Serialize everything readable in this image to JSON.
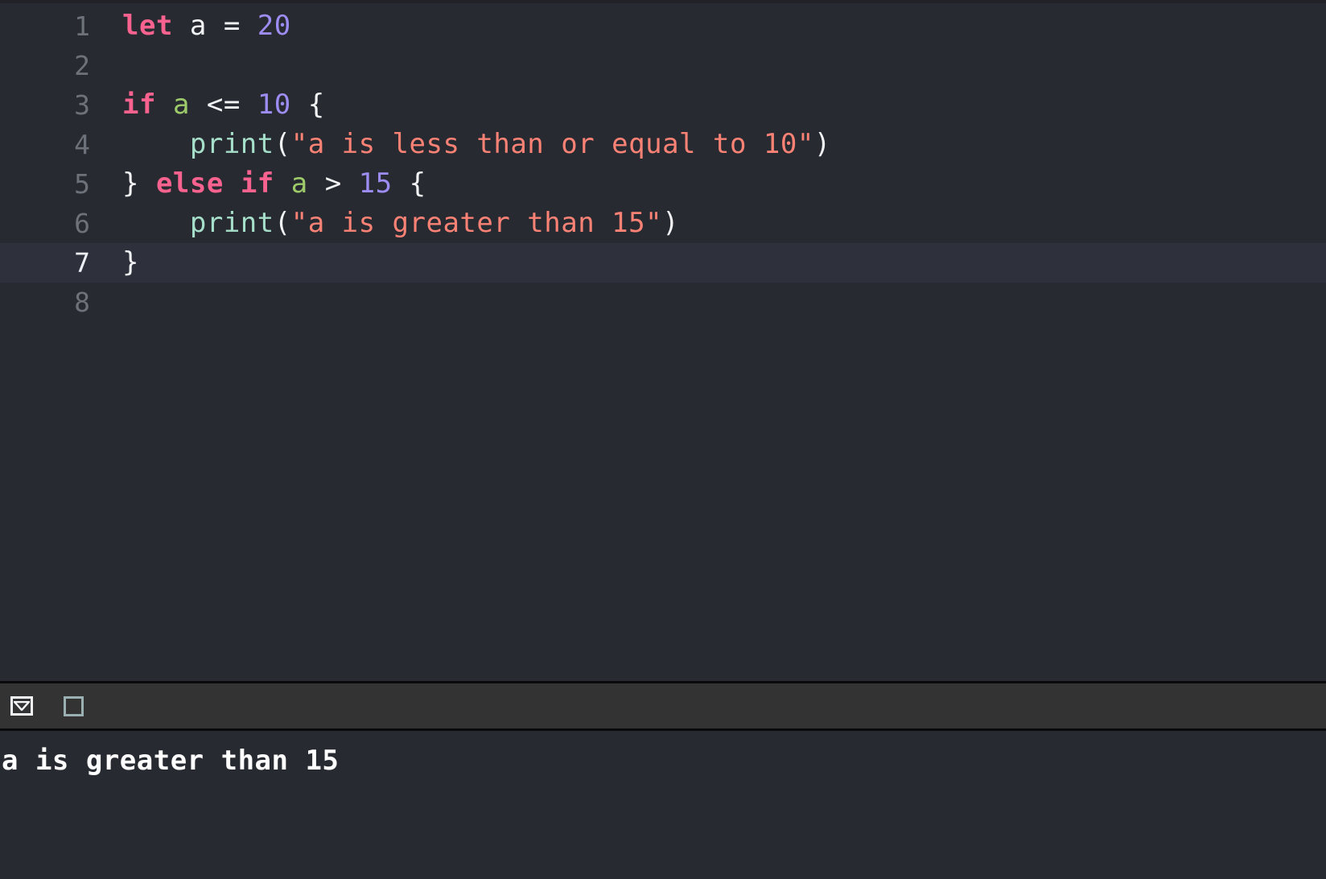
{
  "editor": {
    "language": "swift",
    "active_line": 7,
    "colors": {
      "background": "#272a31",
      "active_line_background": "#2e313b",
      "gutter_text": "#6d7179",
      "keyword": "#f8628f",
      "number": "#9d8df2",
      "variable": "#9ecb6a",
      "function": "#a6dfc9",
      "string": "#fb8275",
      "plain": "#f2f3f5"
    },
    "lines": [
      {
        "number": "1",
        "tokens": [
          {
            "text": "let",
            "type": "kw"
          },
          {
            "text": " a = ",
            "type": "pl"
          },
          {
            "text": "20",
            "type": "num"
          }
        ]
      },
      {
        "number": "2",
        "tokens": []
      },
      {
        "number": "3",
        "tokens": [
          {
            "text": "if",
            "type": "kw"
          },
          {
            "text": " ",
            "type": "pl"
          },
          {
            "text": "a",
            "type": "var"
          },
          {
            "text": " <= ",
            "type": "pl"
          },
          {
            "text": "10",
            "type": "num"
          },
          {
            "text": " {",
            "type": "pl"
          }
        ]
      },
      {
        "number": "4",
        "tokens": [
          {
            "text": "    ",
            "type": "pl"
          },
          {
            "text": "print",
            "type": "fn"
          },
          {
            "text": "(",
            "type": "pl"
          },
          {
            "text": "\"a is less than or equal to 10\"",
            "type": "str"
          },
          {
            "text": ")",
            "type": "pl"
          }
        ]
      },
      {
        "number": "5",
        "tokens": [
          {
            "text": "} ",
            "type": "pl"
          },
          {
            "text": "else",
            "type": "kw"
          },
          {
            "text": " ",
            "type": "pl"
          },
          {
            "text": "if",
            "type": "kw"
          },
          {
            "text": " ",
            "type": "pl"
          },
          {
            "text": "a",
            "type": "var"
          },
          {
            "text": " > ",
            "type": "pl"
          },
          {
            "text": "15",
            "type": "num"
          },
          {
            "text": " {",
            "type": "pl"
          }
        ]
      },
      {
        "number": "6",
        "tokens": [
          {
            "text": "    ",
            "type": "pl"
          },
          {
            "text": "print",
            "type": "fn"
          },
          {
            "text": "(",
            "type": "pl"
          },
          {
            "text": "\"a is greater than 15\"",
            "type": "str"
          },
          {
            "text": ")",
            "type": "pl"
          }
        ]
      },
      {
        "number": "7",
        "active": true,
        "tokens": [
          {
            "text": "}",
            "type": "pl"
          }
        ]
      },
      {
        "number": "8",
        "tokens": []
      }
    ]
  },
  "toolbar": {
    "background": "#333333",
    "buttons": [
      {
        "name": "collapse-console-button",
        "icon": "chevron-down-box-icon",
        "label": ""
      },
      {
        "name": "clear-console-button",
        "icon": "stop-square-icon",
        "label": ""
      }
    ]
  },
  "console": {
    "background": "#272a31",
    "output_lines": [
      "a is greater than 15"
    ]
  }
}
